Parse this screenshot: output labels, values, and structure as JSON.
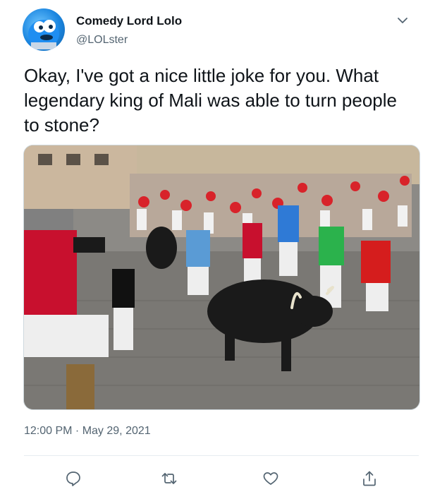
{
  "user": {
    "display_name": "Comedy Lord Lolo",
    "handle": "@LOLster",
    "avatar_icon": "avatar-blue-character"
  },
  "tweet": {
    "text": "Okay, I've got a nice little joke for you. What legendary king of Mali was able to turn people to stone?",
    "timestamp": "12:00 PM · May 29, 2021"
  },
  "media": {
    "description_icon": "photo-bull-run"
  },
  "actions": {
    "reply_icon": "reply-icon",
    "retweet_icon": "retweet-icon",
    "like_icon": "like-icon",
    "share_icon": "share-icon"
  },
  "colors": {
    "text_primary": "#0f1419",
    "text_secondary": "#536471",
    "border": "#cfd9de"
  }
}
